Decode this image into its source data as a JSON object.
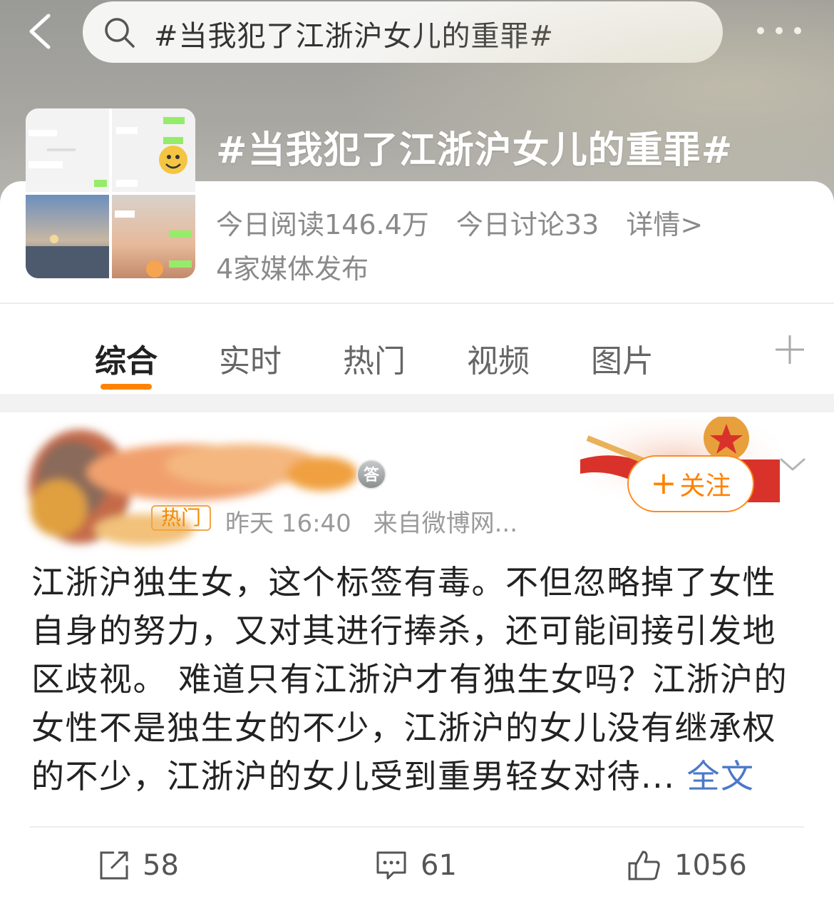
{
  "search": {
    "query": "#当我犯了江浙沪女儿的重罪#"
  },
  "topic": {
    "title": "#当我犯了江浙沪女儿的重罪#",
    "reads_today": "今日阅读146.4万",
    "discussions_today": "今日讨论33",
    "details_link": "详情>",
    "media_count": "4家媒体发布"
  },
  "tabs": [
    {
      "label": "综合",
      "active": true
    },
    {
      "label": "实时",
      "active": false
    },
    {
      "label": "热门",
      "active": false
    },
    {
      "label": "视频",
      "active": false
    },
    {
      "label": "图片",
      "active": false
    }
  ],
  "post": {
    "badge": "答",
    "hot_tag": "热门",
    "time": "昨天 16:40",
    "source": "来自微博网...",
    "follow_label": "关注",
    "text": "江浙沪独生女，这个标签有毒。不但忽略掉了女性自身的努力，又对其进行捧杀，还可能间接引发地区歧视。 难道只有江浙沪才有独生女吗？江浙沪的女性不是独生女的不少，江浙沪的女儿没有继承权的不少，江浙沪的女儿受到重男轻女对待...",
    "full_text_link": "全文",
    "reposts": "58",
    "comments": "61",
    "likes": "1056"
  },
  "colors": {
    "accent": "#ff8200",
    "link": "#4a79c9"
  },
  "icons": [
    "back-arrow-icon",
    "search-icon",
    "more-icon",
    "plus-icon",
    "chevron-down-icon",
    "repost-icon",
    "comment-icon",
    "like-icon"
  ]
}
